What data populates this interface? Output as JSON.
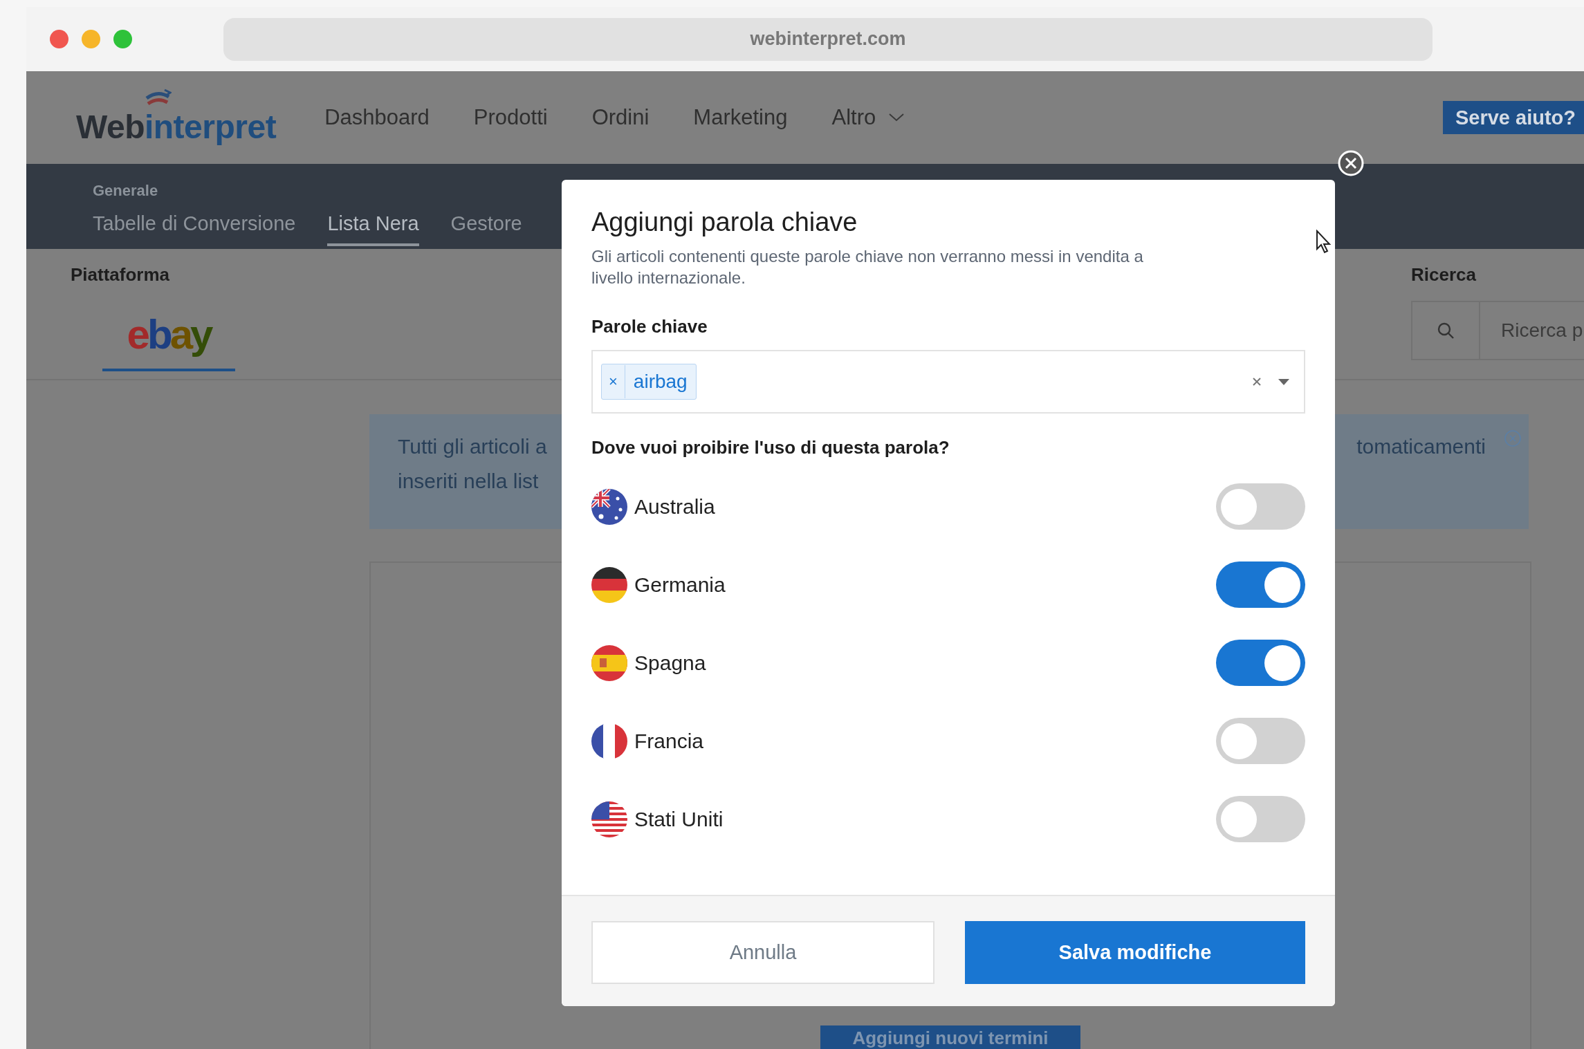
{
  "browser": {
    "url": "webinterpret.com"
  },
  "header": {
    "logo": {
      "dark": "Web",
      "accent": "interpret"
    },
    "nav": [
      {
        "label": "Dashboard",
        "dropdown": false
      },
      {
        "label": "Prodotti",
        "dropdown": false
      },
      {
        "label": "Ordini",
        "dropdown": false
      },
      {
        "label": "Marketing",
        "dropdown": false
      },
      {
        "label": "Altro",
        "dropdown": true
      }
    ],
    "help_button": "Serve aiuto?"
  },
  "subnav": {
    "section": "Generale",
    "tabs": [
      {
        "label": "Tabelle di Conversione",
        "selected": false
      },
      {
        "label": "Lista Nera",
        "selected": true
      },
      {
        "label": "Gestore",
        "selected": false
      }
    ]
  },
  "platform": {
    "label": "Piattaforma",
    "tabs": [
      {
        "label": "ebay",
        "selected": true
      }
    ]
  },
  "search": {
    "label": "Ricerca",
    "placeholder": "Ricerca p"
  },
  "banner": {
    "left_lines": [
      "Tutti gli articoli a",
      "inseriti nella list"
    ],
    "right_lines": [
      "tomaticamenti"
    ]
  },
  "add_button": "Aggiungi nuovi termini",
  "modal": {
    "title": "Aggiungi parola chiave",
    "description": "Gli articoli contenenti queste parole chiave non verranno messi in vendita a livello internazionale.",
    "keywords_label": "Parole chiave",
    "tags": [
      {
        "remove_label": "×",
        "label": "airbag"
      }
    ],
    "question": "Dove vuoi proibire l'uso di questa parola?",
    "countries": [
      {
        "name": "Australia",
        "kind": "au",
        "on": false
      },
      {
        "name": "Germania",
        "kind": "de",
        "on": true
      },
      {
        "name": "Spagna",
        "kind": "es",
        "on": true
      },
      {
        "name": "Francia",
        "kind": "fr",
        "on": false
      },
      {
        "name": "Stati Uniti",
        "kind": "us",
        "on": false
      }
    ],
    "cancel": "Annulla",
    "save": "Salva modifiche"
  }
}
